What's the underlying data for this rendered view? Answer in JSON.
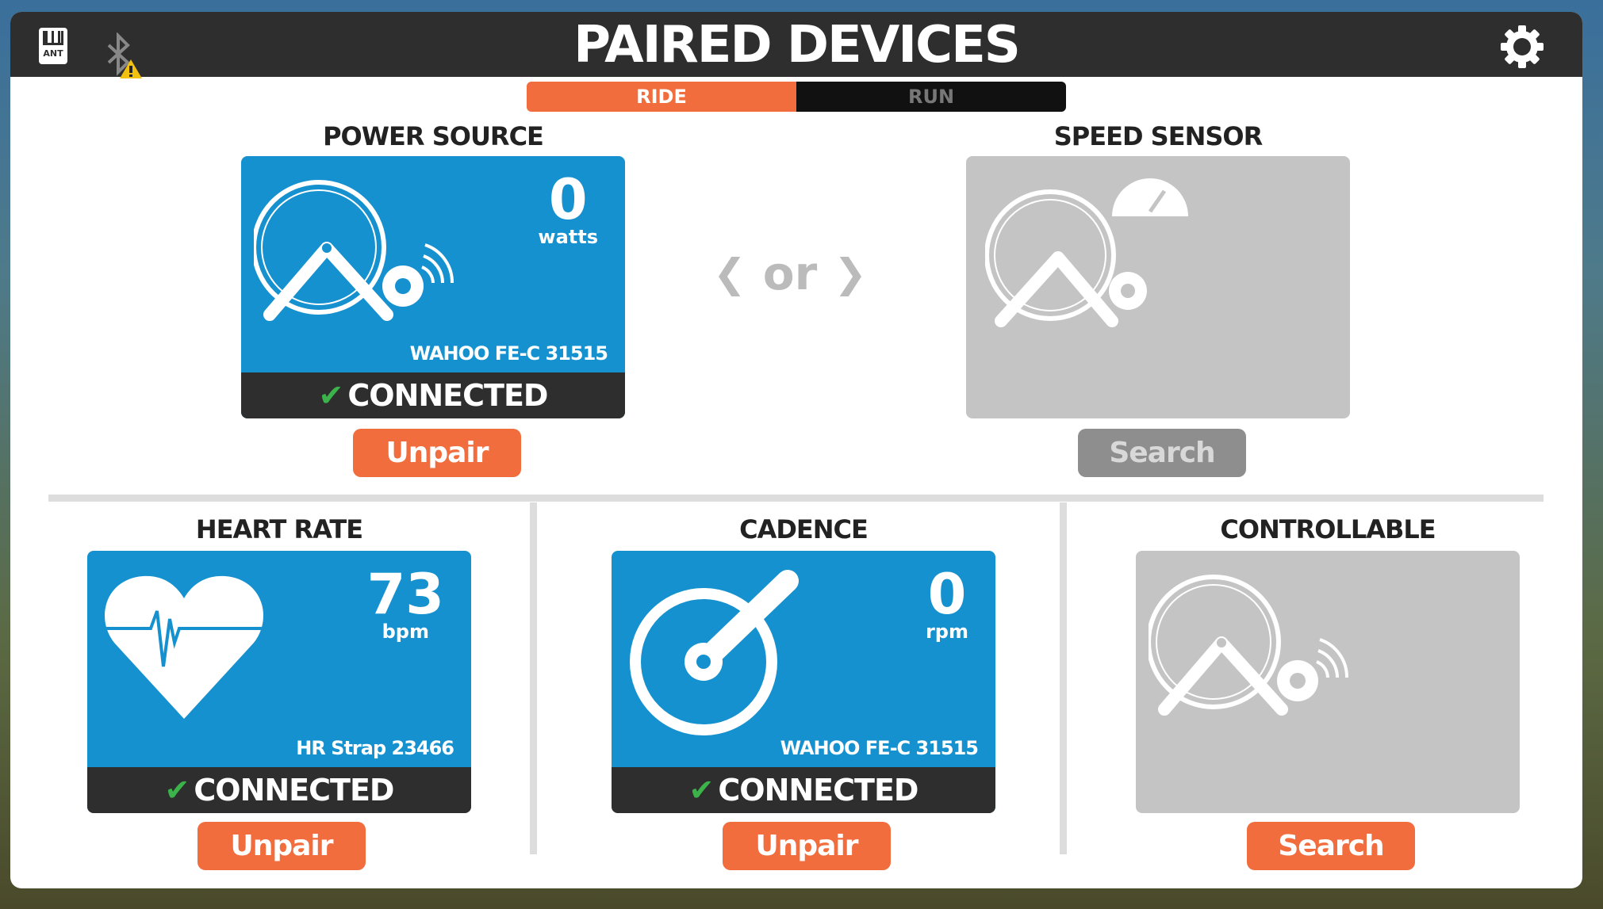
{
  "header": {
    "title": "PAIRED DEVICES",
    "ant_label": "ANT",
    "icons": [
      "ant-icon",
      "bluetooth-warning-icon",
      "gear-icon"
    ]
  },
  "tabs": [
    {
      "label": "RIDE",
      "active": true
    },
    {
      "label": "RUN",
      "active": false
    }
  ],
  "colors": {
    "accent": "#f26d3d",
    "card_active": "#1591cf",
    "card_inactive": "#c4c4c4",
    "connected_check": "#3cb34a",
    "header": "#2e2e2e"
  },
  "power_source": {
    "label": "POWER SOURCE",
    "value": "0",
    "unit": "watts",
    "device": "WAHOO FE-C 31515",
    "status": "CONNECTED",
    "button": "Unpair"
  },
  "or_label": "or",
  "speed_sensor": {
    "label": "SPEED SENSOR",
    "button": "Search"
  },
  "heart_rate": {
    "label": "HEART RATE",
    "value": "73",
    "unit": "bpm",
    "device": "HR Strap 23466",
    "status": "CONNECTED",
    "button": "Unpair"
  },
  "cadence": {
    "label": "CADENCE",
    "value": "0",
    "unit": "rpm",
    "device": "WAHOO FE-C 31515",
    "status": "CONNECTED",
    "button": "Unpair"
  },
  "controllable": {
    "label": "CONTROLLABLE",
    "button": "Search"
  }
}
